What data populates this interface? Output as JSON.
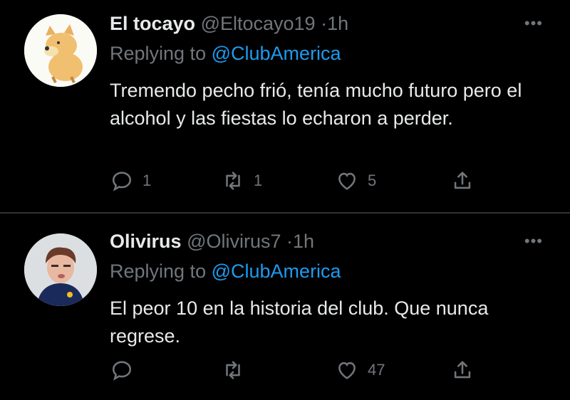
{
  "tweets": [
    {
      "name": "El tocayo",
      "handle": "@Eltocayo19",
      "time": "1h",
      "replying_label": "Replying to",
      "replying_to": "@ClubAmerica",
      "text": "Tremendo pecho frió, tenía mucho futuro pero el alcohol y las fiestas lo echaron a perder.",
      "reply_count": "1",
      "retweet_count": "1",
      "like_count": "5"
    },
    {
      "name": "Olivirus",
      "handle": "@Olivirus7",
      "time": "1h",
      "replying_label": "Replying to",
      "replying_to": "@ClubAmerica",
      "text": "El peor 10 en la historia del club. Que nunca regrese.",
      "reply_count": "",
      "retweet_count": "",
      "like_count": "47"
    }
  ],
  "separator": "·",
  "more": "•••",
  "icons": [
    "reply-icon",
    "retweet-icon",
    "like-icon",
    "share-icon"
  ],
  "colors": {
    "background": "#000000",
    "accent": "#1d9bf0",
    "muted": "#71767b",
    "text": "#e7e9ea"
  }
}
